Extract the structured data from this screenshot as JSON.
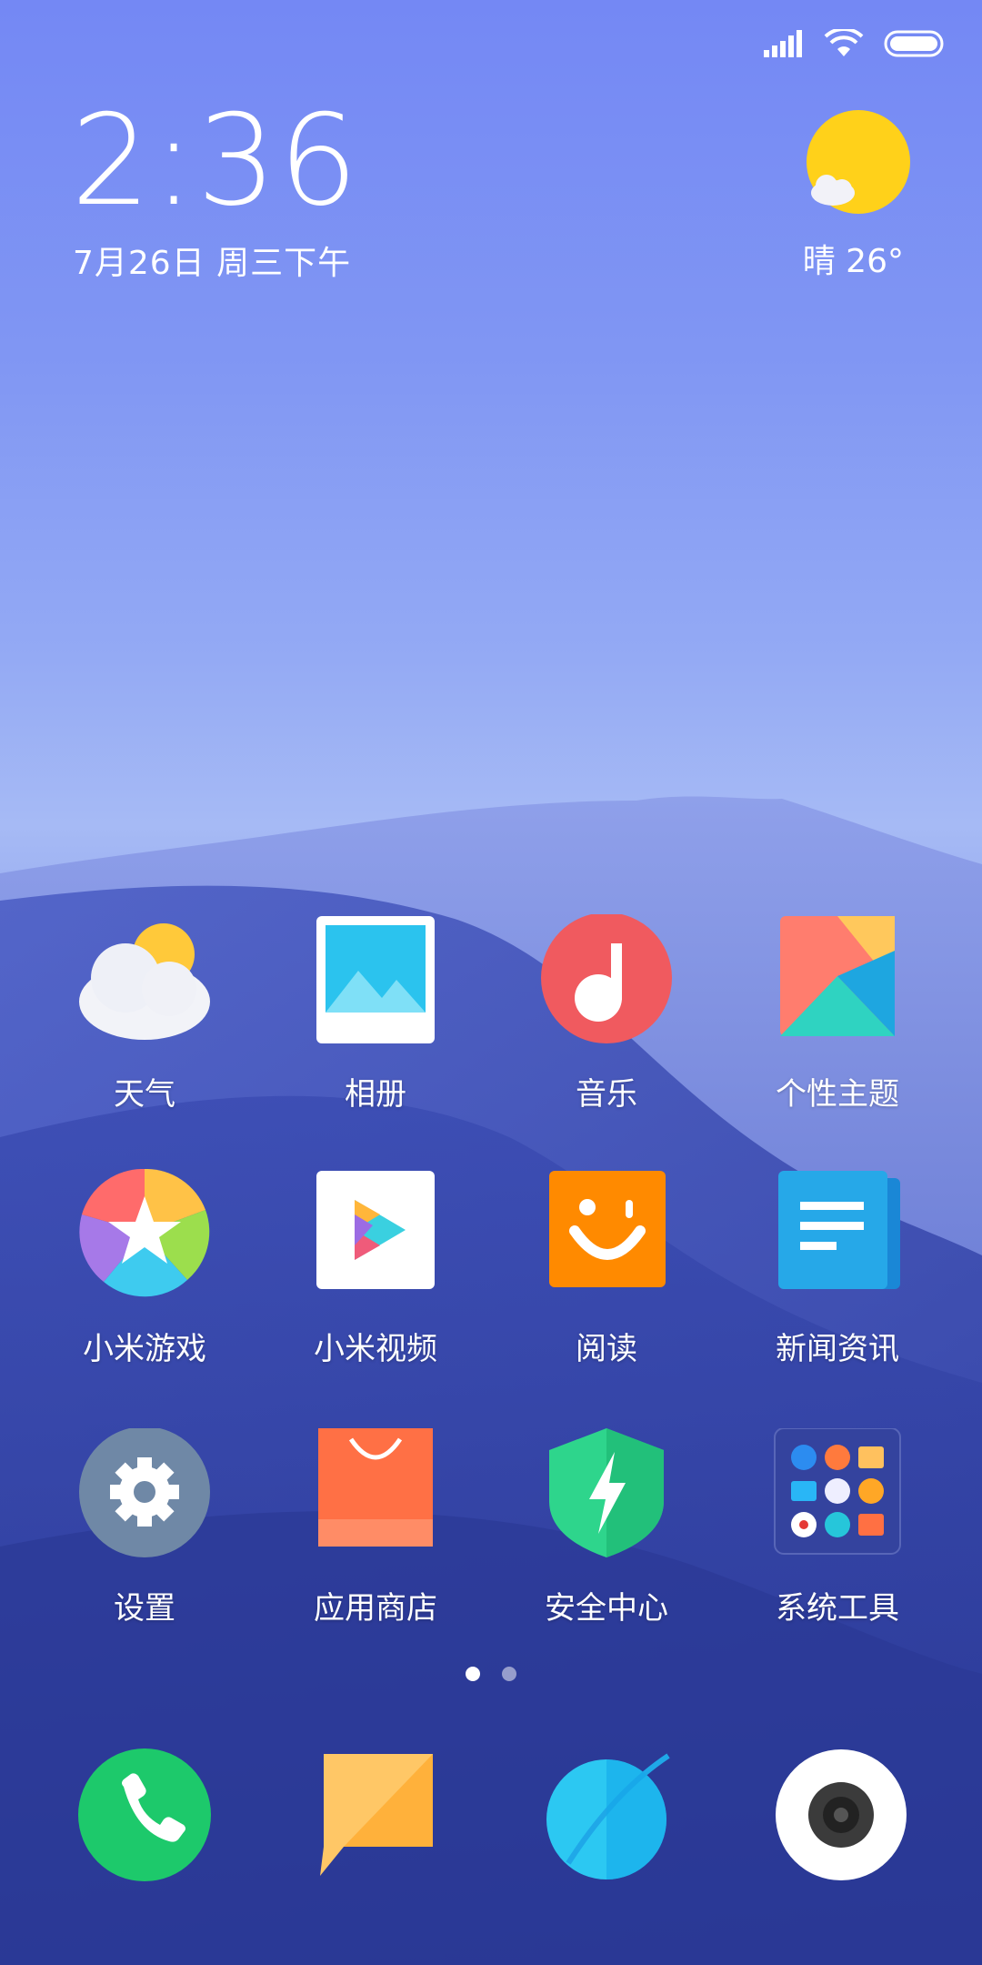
{
  "status_bar": {
    "icons": [
      "signal-icon",
      "wifi-icon",
      "battery-icon"
    ]
  },
  "clock": {
    "time": "2:36",
    "date": "7月26日  周三下午"
  },
  "weather": {
    "icon": "sun-cloud-icon",
    "text": "晴 26°"
  },
  "apps": [
    {
      "label": "天气",
      "icon": "weather-icon"
    },
    {
      "label": "相册",
      "icon": "gallery-icon"
    },
    {
      "label": "音乐",
      "icon": "music-icon"
    },
    {
      "label": "个性主题",
      "icon": "themes-icon"
    },
    {
      "label": "小米游戏",
      "icon": "games-icon"
    },
    {
      "label": "小米视频",
      "icon": "video-icon"
    },
    {
      "label": "阅读",
      "icon": "reading-icon"
    },
    {
      "label": "新闻资讯",
      "icon": "news-icon"
    },
    {
      "label": "设置",
      "icon": "settings-icon"
    },
    {
      "label": "应用商店",
      "icon": "app-store-icon"
    },
    {
      "label": "安全中心",
      "icon": "security-icon"
    },
    {
      "label": "系统工具",
      "icon": "system-tools-folder-icon"
    }
  ],
  "pages": {
    "count": 2,
    "current": 1
  },
  "dock": [
    {
      "icon": "phone-icon"
    },
    {
      "icon": "messages-icon"
    },
    {
      "icon": "browser-icon"
    },
    {
      "icon": "camera-icon"
    }
  ],
  "colors": {
    "sky_top": "#7488f4",
    "dune_dark": "#2f3ea0",
    "music_red": "#f05a5f",
    "reading_orange": "#ff8a00",
    "security_green": "#2ed58c"
  }
}
